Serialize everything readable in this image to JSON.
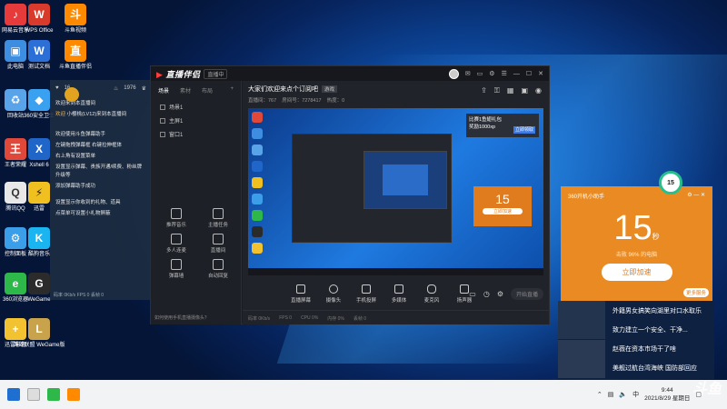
{
  "desktop": {
    "icons": [
      {
        "label": "网易云音乐",
        "color": "#e73a3a"
      },
      {
        "label": "WPS Office",
        "color": "#d83b2b"
      },
      {
        "label": "斗鱼视频",
        "color": "#ff8a00"
      },
      {
        "label": "此电脑",
        "color": "#3d8de0"
      },
      {
        "label": "测试文档",
        "color": "#2c6fd6"
      },
      {
        "label": "斗鱼直播伴侣",
        "color": "#ff8a00"
      },
      {
        "label": "回收站",
        "color": "#59a3e8"
      },
      {
        "label": "360安全卫士",
        "color": "#3aa0f0"
      },
      {
        "label": "王者荣耀",
        "color": "#e0493a"
      },
      {
        "label": "Xshell 6",
        "color": "#1f66c8"
      },
      {
        "label": "腾讯QQ",
        "color": "#e8e8e8"
      },
      {
        "label": "迅雷",
        "color": "#f0c020"
      },
      {
        "label": "控制面板",
        "color": "#3a9ee8"
      },
      {
        "label": "酷狗音乐",
        "color": "#1ab4f0"
      },
      {
        "label": "360浏览器",
        "color": "#2fb84a"
      },
      {
        "label": "WeGame",
        "color": "#2b2b2b"
      },
      {
        "label": "迅雷影音",
        "color": "#f2c230"
      },
      {
        "label": "英雄联盟 WeGame版",
        "color": "#c9a24c"
      }
    ]
  },
  "chat": {
    "header": {
      "count": "16",
      "level": "1976"
    },
    "messages": [
      {
        "user": "",
        "text": "欢迎来到本直播间"
      },
      {
        "user": "欢迎",
        "text": "小樱桃(LV12)来到本直播间"
      },
      {
        "user": "",
        "text": "欢迎使用斗鱼弹幕助手"
      },
      {
        "user": "",
        "text": "左键拖拽弹幕框 右键拉伸框体"
      },
      {
        "user": "",
        "text": "右上角有设置菜单"
      },
      {
        "user": "",
        "text": "设置显示弹幕、贵族开通/续费、粉丝牌升级等"
      },
      {
        "user": "",
        "text": "添加弹幕助手成功"
      },
      {
        "user": "",
        "text": "设置显示你收到的礼物、道具"
      },
      {
        "user": "",
        "text": "点菜单可设置小礼物屏蔽"
      }
    ],
    "footer": "码率 0Kb/s FPS 0 丢帧 0"
  },
  "app": {
    "logo": "直播伴侣",
    "version": "直播中",
    "left_tabs": [
      "场景",
      "素材",
      "布局"
    ],
    "scenes": [
      "场景1",
      "主屏1",
      "窗口1"
    ],
    "tools": [
      "推荐音乐",
      "主播任务",
      "多人连麦",
      "直播间",
      "弹幕墙",
      "自动回复"
    ],
    "left_footer": "如何使用手机直播摄像头？",
    "stream_title": "大家们欢迎来点个订阅吧",
    "stream_tag": "游戏",
    "stream_sub": [
      "直播间：767",
      "房间号：7278417",
      "热度：0"
    ],
    "ctrl_buttons": [
      "直播屏幕",
      "摄像头",
      "手机投屏",
      "多媒体",
      "麦克风",
      "扬声器"
    ],
    "golive_label": "开始直播",
    "status": [
      "码率 0Kb/s",
      "FPS 0",
      "CPU 0%",
      "内存 0%",
      "丢帧 0"
    ],
    "preview_ad": {
      "title": "比赛1鱼翅礼包",
      "sub": "奖励1000xp",
      "cta": "立即领取"
    },
    "preview_timer": {
      "value": "15",
      "cta": "立即加速"
    }
  },
  "widget": {
    "title": "360开机小助手",
    "value": "15",
    "unit": "秒",
    "subtitle": "击败 96% 的电脑",
    "button": "立即加速",
    "footer": "更多服务",
    "badge": "15"
  },
  "news": [
    {
      "text": "外籍男女搞笑向湖里对口水取乐"
    },
    {
      "text": "致力建立一个安全、干净..."
    },
    {
      "text": "赵薇在资本市场干了啥"
    },
    {
      "text": "美舰过航台湾海峡 国防部回应"
    }
  ],
  "taskbar": {
    "time": "9:44",
    "date": "2021/8/29 星期日",
    "watermark": "斗鱼"
  }
}
